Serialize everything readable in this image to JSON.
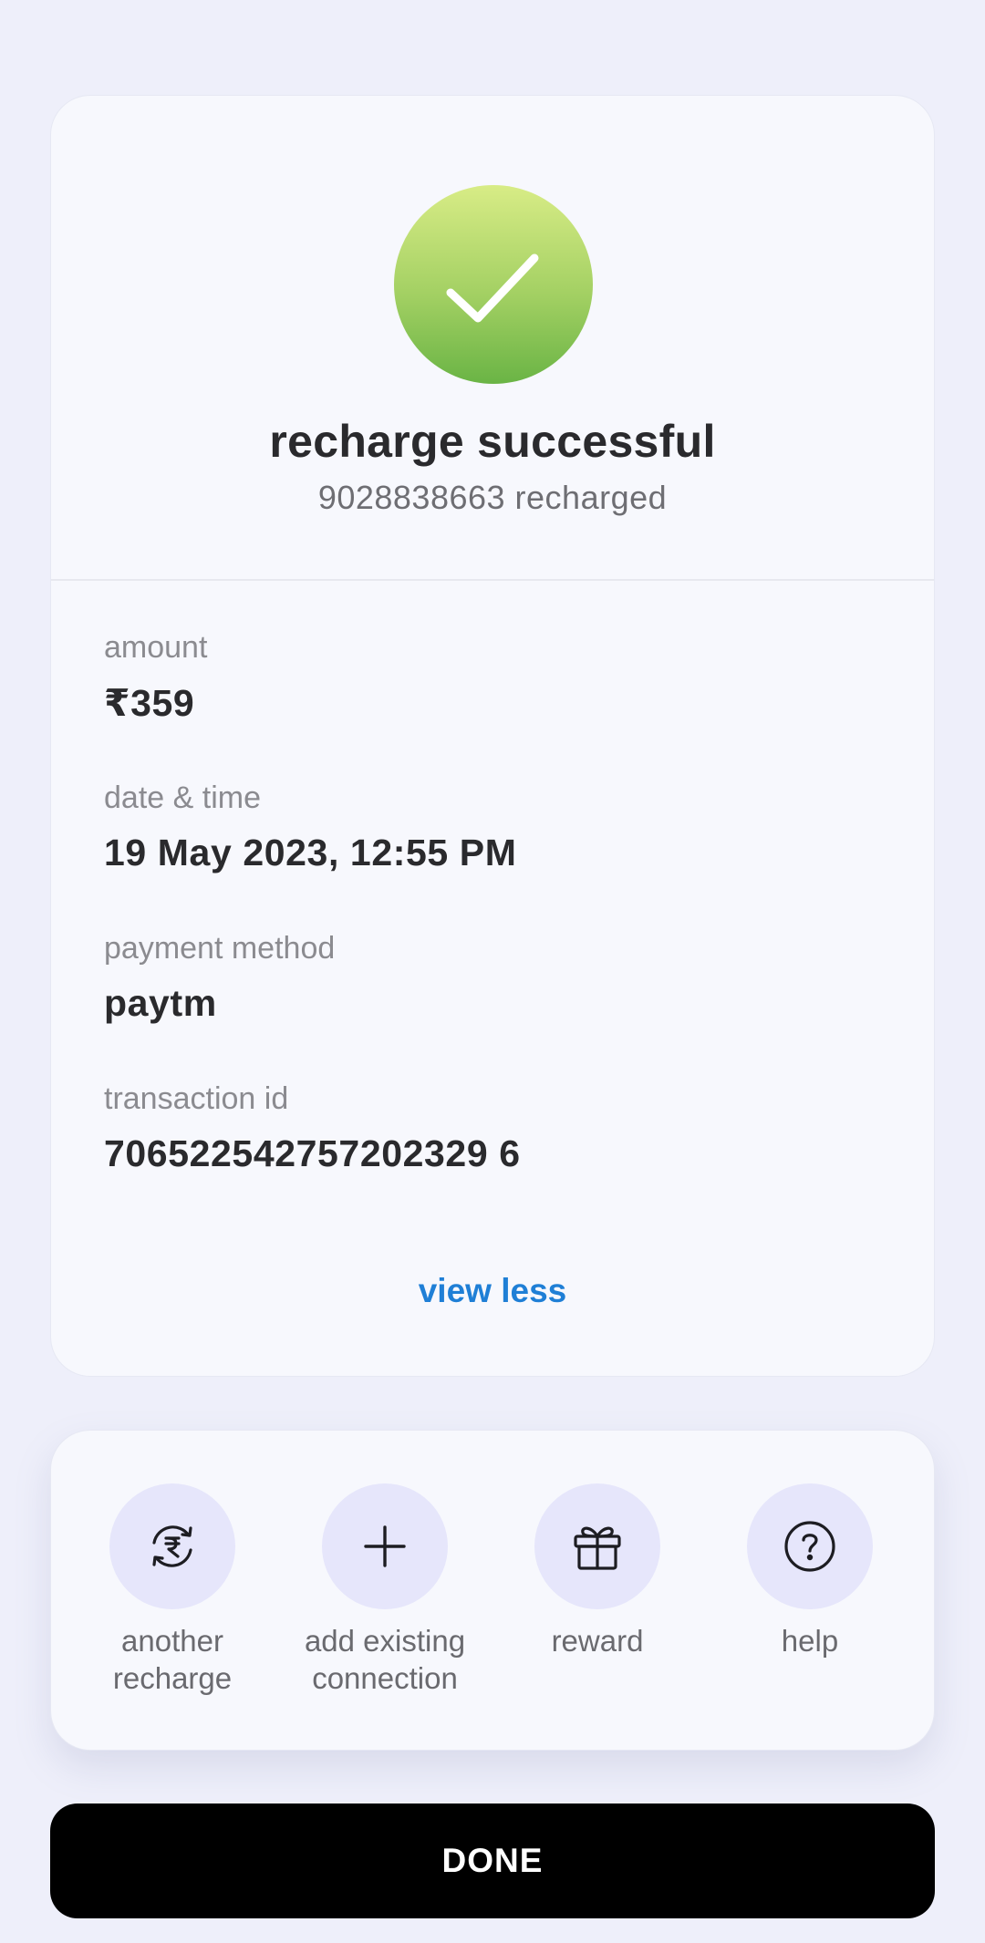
{
  "status": {
    "title": "recharge successful",
    "subtitle": "9028838663 recharged",
    "icon": "checkmark-icon"
  },
  "details": [
    {
      "label": "amount",
      "value": "₹359"
    },
    {
      "label": "date & time",
      "value": "19 May 2023, 12:55 PM"
    },
    {
      "label": "payment method",
      "value": "paytm"
    },
    {
      "label": "transaction id",
      "value": "706522542757202329 6"
    }
  ],
  "toggle_label": "view less",
  "actions": [
    {
      "label": "another\nrecharge",
      "icon": "rupee-refresh-icon"
    },
    {
      "label": "add existing\nconnection",
      "icon": "plus-icon"
    },
    {
      "label": "reward",
      "icon": "gift-icon"
    },
    {
      "label": "help",
      "icon": "help-icon"
    }
  ],
  "done_label": "DONE",
  "colors": {
    "accent_link": "#1f7fd6",
    "success_green": "#7fbf4f",
    "action_bubble": "#e6e6fb",
    "background": "#eeeffa"
  }
}
